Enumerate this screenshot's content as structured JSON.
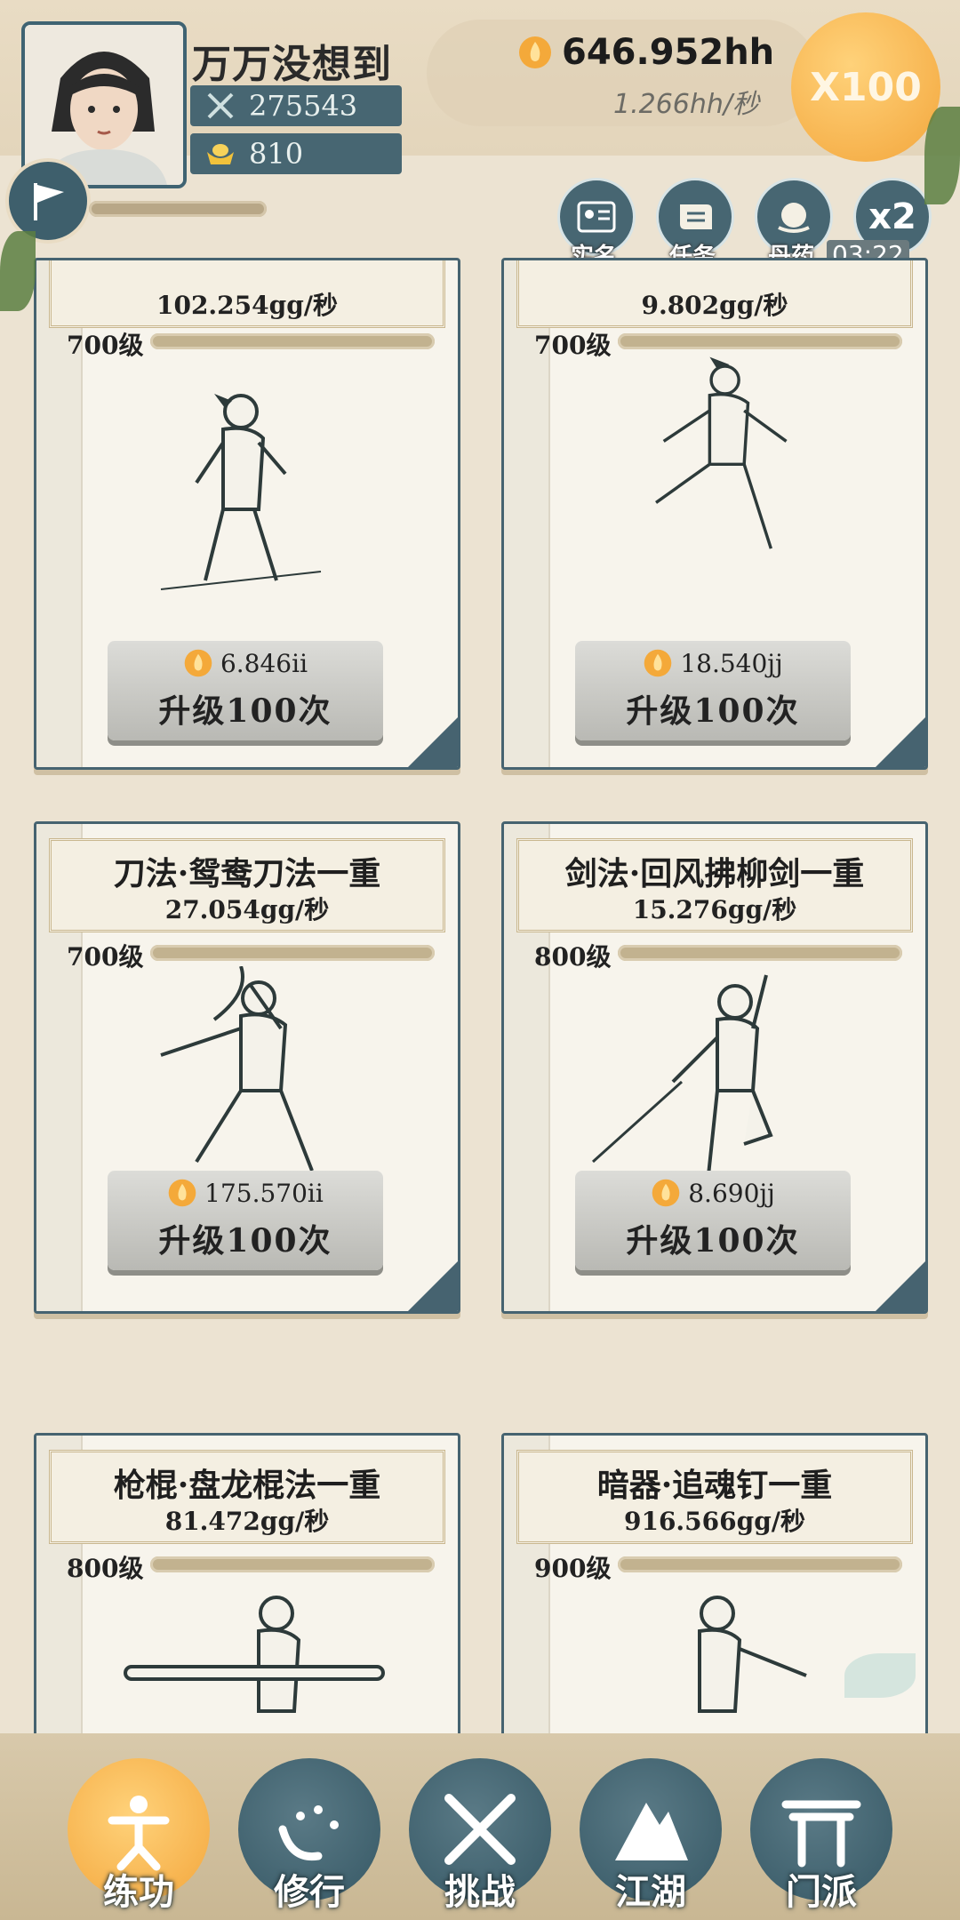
{
  "player": {
    "name": "万万没想到",
    "power": "275543",
    "gold_ingots": "810"
  },
  "currency": {
    "amount": "646.952hh",
    "rate": "1.266hh/秒",
    "multiplier": "X100"
  },
  "quick_buttons": [
    {
      "label": "实名",
      "icon": "id-card-icon"
    },
    {
      "label": "任务",
      "icon": "scroll-icon"
    },
    {
      "label": "丹药",
      "icon": "pill-icon"
    },
    {
      "label": "x2",
      "icon": "double-icon"
    }
  ],
  "timer": "03:22",
  "cards": [
    {
      "title": "",
      "rate": "102.254gg/秒",
      "level": "700级",
      "cost": "6.846ii",
      "button": "升级100次"
    },
    {
      "title": "",
      "rate": "9.802gg/秒",
      "level": "700级",
      "cost": "18.540jj",
      "button": "升级100次"
    },
    {
      "title": "刀法·鸳鸯刀法一重",
      "rate": "27.054gg/秒",
      "level": "700级",
      "cost": "175.570ii",
      "button": "升级100次"
    },
    {
      "title": "剑法·回风拂柳剑一重",
      "rate": "15.276gg/秒",
      "level": "800级",
      "cost": "8.690jj",
      "button": "升级100次"
    },
    {
      "title": "枪棍·盘龙棍法一重",
      "rate": "81.472gg/秒",
      "level": "800级",
      "cost": "",
      "button": ""
    },
    {
      "title": "暗器·追魂钉一重",
      "rate": "916.566gg/秒",
      "level": "900级",
      "cost": "",
      "button": ""
    }
  ],
  "nav": [
    {
      "label": "练功",
      "icon": "practice-icon"
    },
    {
      "label": "修行",
      "icon": "heart-icon"
    },
    {
      "label": "挑战",
      "icon": "crossed-swords-icon"
    },
    {
      "label": "江湖",
      "icon": "mountain-icon"
    },
    {
      "label": "门派",
      "icon": "gate-icon"
    }
  ],
  "colors": {
    "accent": "#476672",
    "highlight": "#f3a63c",
    "paper": "#ece3d2"
  }
}
